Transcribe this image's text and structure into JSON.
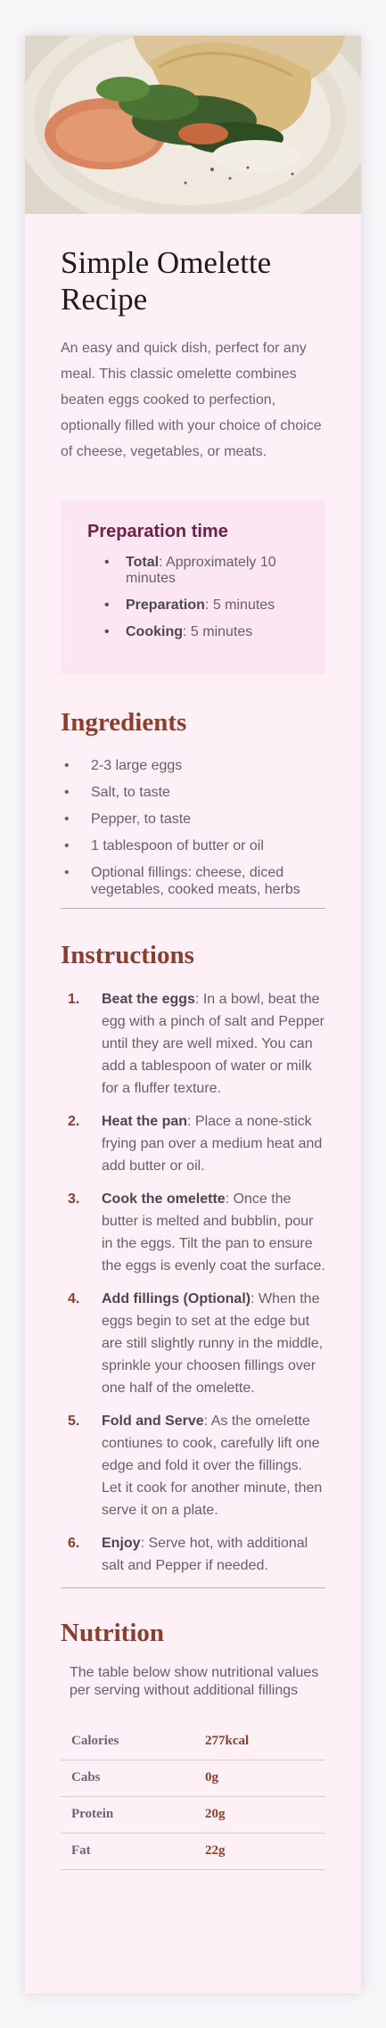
{
  "recipe": {
    "title": "Simple Omelette Recipe",
    "intro": "An easy and quick dish, perfect for any meal. This classic omelette combines beaten eggs cooked to perfection, optionally filled with your choice of choice of cheese, vegetables, or meats."
  },
  "prep": {
    "heading": "Preparation time",
    "items": [
      {
        "label": "Total",
        "value": ": Approximately 10 minutes"
      },
      {
        "label": "Preparation",
        "value": ": 5 minutes"
      },
      {
        "label": "Cooking",
        "value": ": 5 minutes"
      }
    ]
  },
  "ingredients": {
    "heading": "Ingredients",
    "items": [
      "2-3 large eggs",
      "Salt, to taste",
      "Pepper, to taste",
      "1 tablespoon of butter or oil",
      "Optional fillings: cheese, diced vegetables, cooked meats, herbs"
    ]
  },
  "instructions": {
    "heading": "Instructions",
    "steps": [
      {
        "num": "1.",
        "label": "Beat the eggs",
        "text": ": In a bowl, beat the egg with a pinch of salt and Pepper until they are well mixed. You can add a tablespoon of water or milk for a fluffer texture."
      },
      {
        "num": "2.",
        "label": "Heat the pan",
        "text": ": Place a none-stick frying pan over a medium heat and add butter or oil."
      },
      {
        "num": "3.",
        "label": "Cook the omelette",
        "text": ": Once the butter is melted and bubblin, pour in the eggs. Tilt the pan to ensure the eggs is evenly coat the surface."
      },
      {
        "num": "4.",
        "label": "Add fillings (Optional)",
        "text": ": When the eggs begin to set at the edge but are still slightly runny in the middle, sprinkle your choosen fillings over one half of the omelette."
      },
      {
        "num": "5.",
        "label": "Fold and Serve",
        "text": ": As the omelette contiunes to cook, carefully lift one edge and fold it over the fillings. Let it cook for another minute, then serve it on a plate."
      },
      {
        "num": "6.",
        "label": "Enjoy",
        "text": ": Serve hot, with additional salt and Pepper if needed."
      }
    ]
  },
  "nutrition": {
    "heading": "Nutrition",
    "description": "The table below show nutritional values per serving without additional fillings",
    "rows": [
      {
        "name": "Calories",
        "value": "277kcal"
      },
      {
        "name": "Cabs",
        "value": "0g"
      },
      {
        "name": "Protein",
        "value": "20g"
      },
      {
        "name": "Fat",
        "value": "22g"
      }
    ]
  },
  "colors": {
    "card_background": "#fdf0f7",
    "accent_heading": "#8a3e2b",
    "prep_heading": "#6b2148",
    "prep_background": "#fbe6f1"
  }
}
